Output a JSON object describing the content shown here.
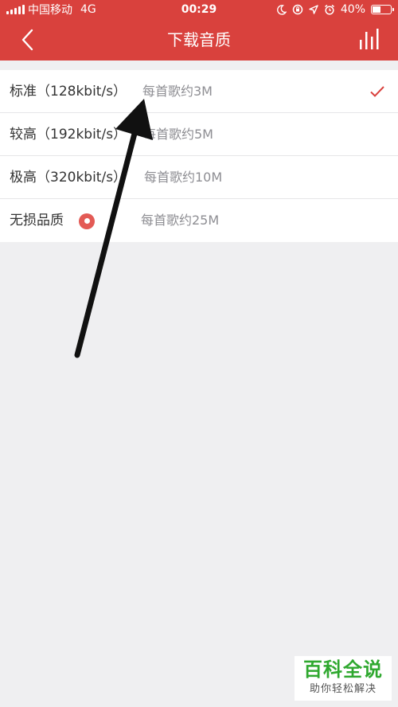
{
  "status_bar": {
    "carrier": "中国移动",
    "network": "4G",
    "time": "00:29",
    "battery_percent": "40%",
    "icons": [
      "moon-icon",
      "rotation-lock-icon",
      "location-icon",
      "alarm-icon",
      "battery-icon"
    ]
  },
  "nav": {
    "title": "下载音质",
    "back_icon": "chevron-left-icon",
    "right_icon": "equalizer-bars-icon",
    "color": "#d9413d"
  },
  "quality_options": [
    {
      "label": "标准（128kbit/s）",
      "desc": "每首歌约3M",
      "selected": true
    },
    {
      "label": "较高（192kbit/s）",
      "desc": "每首歌约5M",
      "selected": false
    },
    {
      "label": "极高（320kbit/s）",
      "desc": "每首歌约10M",
      "selected": false
    },
    {
      "label": "无损品质",
      "desc": "每首歌约25M",
      "selected": false,
      "badge_icon": "lossless-disc-icon"
    }
  ],
  "watermark": {
    "title": "百科全说",
    "subtitle": "助你轻松解决"
  }
}
